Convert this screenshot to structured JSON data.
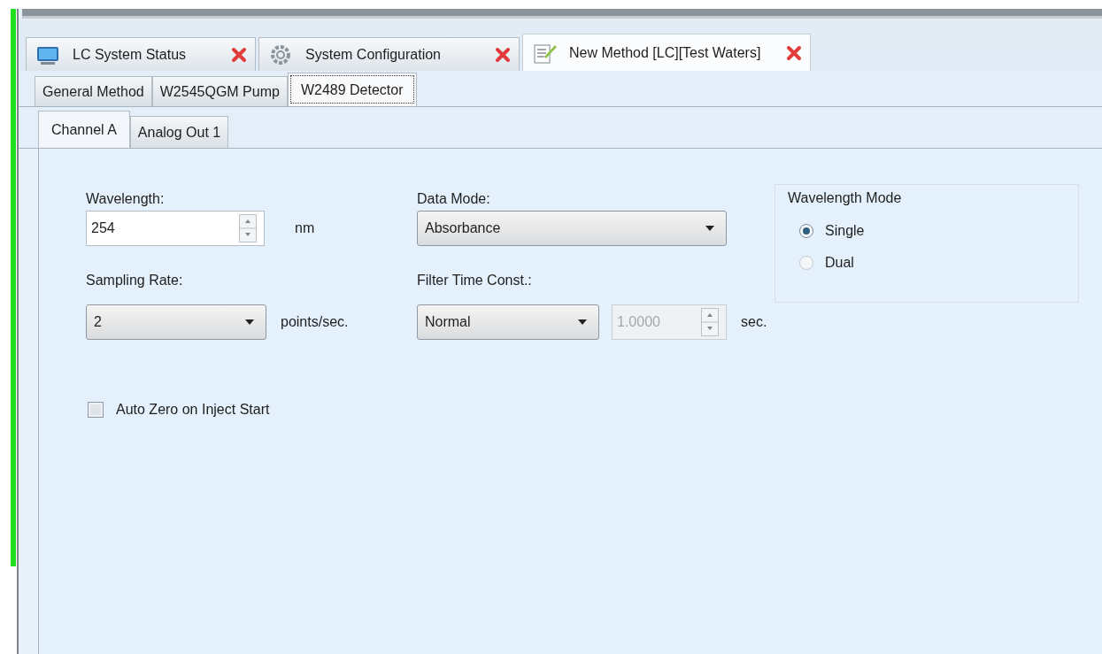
{
  "document_tabs": [
    {
      "kind": "monitor",
      "label": "LC System Status",
      "selected": false
    },
    {
      "kind": "gear",
      "label": "System Configuration",
      "selected": false
    },
    {
      "kind": "edit",
      "label": "New Method [LC][Test Waters]",
      "selected": true
    }
  ],
  "method_tabs": [
    {
      "label": "General Method",
      "selected": false
    },
    {
      "label": "W2545QGM Pump",
      "selected": false
    },
    {
      "label": "W2489 Detector",
      "selected": true
    }
  ],
  "channel_tabs": [
    {
      "label": "Channel A",
      "selected": true
    },
    {
      "label": "Analog Out 1",
      "selected": false
    }
  ],
  "wavelength": {
    "label": "Wavelength:",
    "value": "254",
    "unit": "nm"
  },
  "data_mode": {
    "label": "Data Mode:",
    "value": "Absorbance"
  },
  "wavelength_mode": {
    "title": "Wavelength Mode",
    "options": [
      {
        "label": "Single",
        "selected": true
      },
      {
        "label": "Dual",
        "selected": false
      }
    ]
  },
  "sampling_rate": {
    "label": "Sampling Rate:",
    "value": "2",
    "unit": "points/sec."
  },
  "filter_time_const": {
    "label": "Filter Time Const.:",
    "value": "Normal",
    "time_value": "1.0000",
    "time_disabled": true,
    "unit": "sec."
  },
  "auto_zero": {
    "label": "Auto Zero on Inject Start",
    "checked": false
  }
}
